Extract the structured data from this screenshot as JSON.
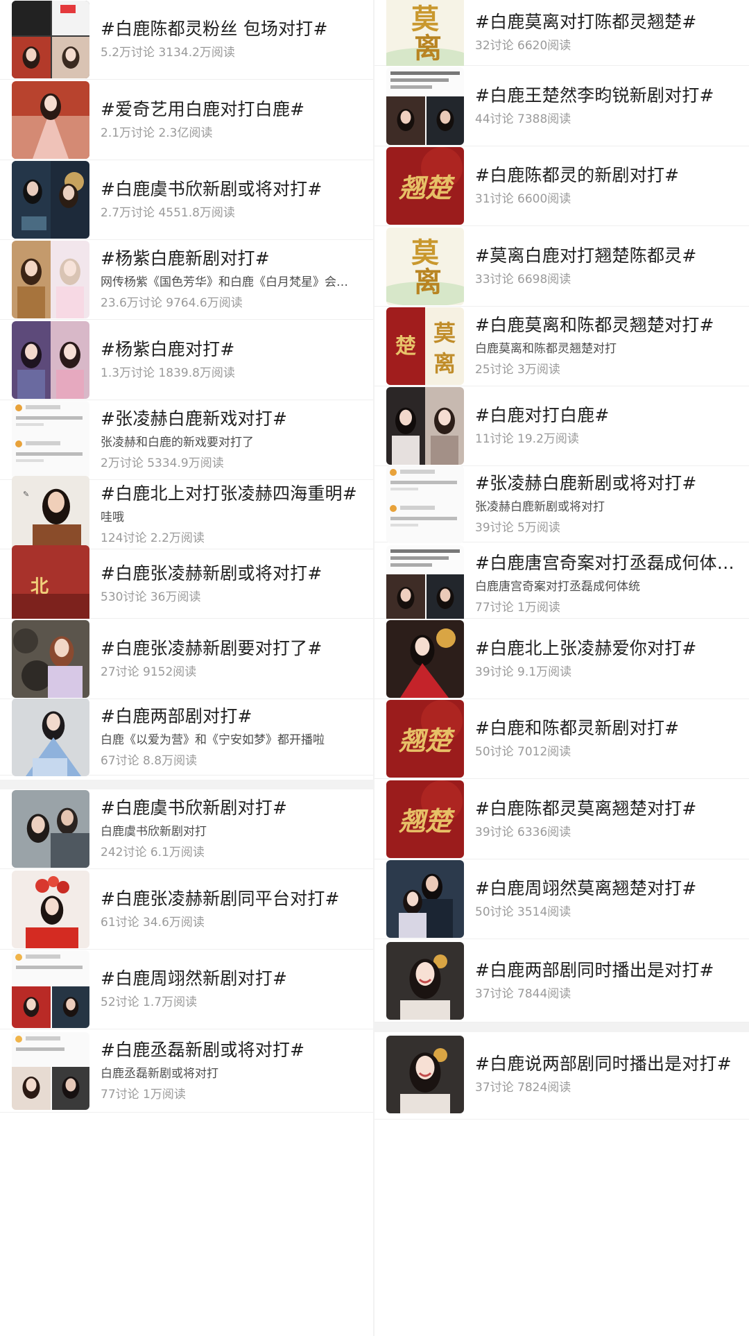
{
  "left_column": [
    {
      "title": "#白鹿陈都灵粉丝 包场对打#",
      "desc": "",
      "stats": "5.2万讨论 3134.2万阅读",
      "thumb": "collage-dark"
    },
    {
      "title": "#爱奇艺用白鹿对打白鹿#",
      "desc": "",
      "stats": "2.1万讨论 2.3亿阅读",
      "thumb": "costume-pink"
    },
    {
      "title": "#白鹿虞书欣新剧或将对打#",
      "desc": "",
      "stats": "2.7万讨论 4551.8万阅读",
      "thumb": "poster-night"
    },
    {
      "title": "#杨紫白鹿新剧对打#",
      "desc": "网传杨紫《国色芳华》和白鹿《白月梵星》会…",
      "stats": "23.6万讨论 9764.6万阅读",
      "thumb": "duo-portrait"
    },
    {
      "title": "#杨紫白鹿对打#",
      "desc": "",
      "stats": "1.3万讨论 1839.8万阅读",
      "thumb": "duo-costume"
    },
    {
      "title": "#张凌赫白鹿新戏对打#",
      "desc": "张凌赫和白鹿的新戏要对打了",
      "stats": "2万讨论 5334.9万阅读",
      "thumb": "weibo-screenshot"
    },
    {
      "title": "#白鹿北上对打张凌赫四海重明#",
      "desc": "哇哦",
      "stats": "124讨论 2.2万阅读",
      "thumb": "portrait-brown"
    },
    {
      "title": "#白鹿张凌赫新剧或将对打#",
      "desc": "",
      "stats": "530讨论 36万阅读",
      "thumb": "red-poster"
    },
    {
      "title": "#白鹿张凌赫新剧要对打了#",
      "desc": "",
      "stats": "27讨论 9152阅读",
      "thumb": "rocks-portrait"
    },
    {
      "title": "#白鹿两部剧对打#",
      "desc": "白鹿《以爱为营》和《宁安如梦》都开播啦",
      "stats": "67讨论 8.8万阅读",
      "thumb": "blue-costume"
    },
    {
      "title": "#白鹿虞书欣新剧对打#",
      "desc": "白鹿虞书欣新剧对打",
      "stats": "242讨论 6.1万阅读",
      "thumb": "couple-grey"
    },
    {
      "title": "#白鹿张凌赫新剧同平台对打#",
      "desc": "",
      "stats": "61讨论 34.6万阅读",
      "thumb": "red-headdress"
    },
    {
      "title": "#白鹿周翊然新剧对打#",
      "desc": "",
      "stats": "52讨论 1.7万阅读",
      "thumb": "weibo-collage"
    },
    {
      "title": "#白鹿丞磊新剧或将对打#",
      "desc": "白鹿丞磊新剧或将对打",
      "stats": "77讨论 1万阅读",
      "thumb": "weibo-collage2"
    }
  ],
  "right_column": [
    {
      "title": "#白鹿莫离对打陈都灵翘楚#",
      "desc": "",
      "stats": "32讨论 6620阅读",
      "thumb": "moli-gold"
    },
    {
      "title": "#白鹿王楚然李昀锐新剧对打#",
      "desc": "",
      "stats": "44讨论 7388阅读",
      "thumb": "text-collage"
    },
    {
      "title": "#白鹿陈都灵的新剧对打#",
      "desc": "",
      "stats": "31讨论 6600阅读",
      "thumb": "qiaochu-red"
    },
    {
      "title": "#莫离白鹿对打翘楚陈都灵#",
      "desc": "",
      "stats": "33讨论 6698阅读",
      "thumb": "moli-gold"
    },
    {
      "title": "#白鹿莫离和陈都灵翘楚对打#",
      "desc": "白鹿莫离和陈都灵翘楚对打",
      "stats": "25讨论 3万阅读",
      "thumb": "split-red-gold"
    },
    {
      "title": "#白鹿对打白鹿#",
      "desc": "",
      "stats": "11讨论 19.2万阅读",
      "thumb": "duo-portrait2"
    },
    {
      "title": "#张凌赫白鹿新剧或将对打#",
      "desc": "张凌赫白鹿新剧或将对打",
      "stats": "39讨论 5万阅读",
      "thumb": "weibo-screenshot"
    },
    {
      "title": "#白鹿唐宫奇案对打丞磊成何体统#",
      "desc": "白鹿唐宫奇案对打丞磊成何体统",
      "stats": "77讨论 1万阅读",
      "thumb": "text-collage2"
    },
    {
      "title": "#白鹿北上张凌赫爱你对打#",
      "desc": "",
      "stats": "39讨论 9.1万阅读",
      "thumb": "red-dress"
    },
    {
      "title": "#白鹿和陈都灵新剧对打#",
      "desc": "",
      "stats": "50讨论 7012阅读",
      "thumb": "qiaochu-red"
    },
    {
      "title": "#白鹿陈都灵莫离翘楚对打#",
      "desc": "",
      "stats": "39讨论 6336阅读",
      "thumb": "qiaochu-red"
    },
    {
      "title": "#白鹿周翊然莫离翘楚对打#",
      "desc": "",
      "stats": "50讨论 3514阅读",
      "thumb": "couple-costume"
    },
    {
      "title": "#白鹿两部剧同时播出是对打#",
      "desc": "",
      "stats": "37讨论 7844阅读",
      "thumb": "smile-portrait"
    },
    {
      "title": "#白鹿说两部剧同时播出是对打#",
      "desc": "",
      "stats": "37讨论 7824阅读",
      "thumb": "smile-portrait"
    }
  ],
  "thumb_text": {
    "moli": "莫离",
    "qiaochu": "翘楚"
  }
}
